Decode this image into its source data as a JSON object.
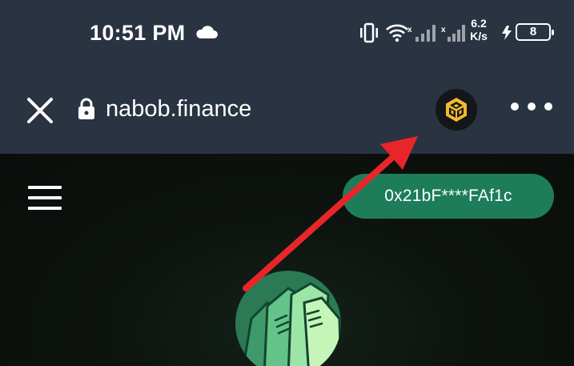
{
  "status_bar": {
    "time": "10:51 PM",
    "net_speed_value": "6.2",
    "net_speed_unit": "K/s",
    "battery_level": "8",
    "icons": [
      "cloud-icon",
      "vibrate-icon",
      "wifi-icon",
      "signal-icon",
      "signal-icon",
      "charging-icon",
      "battery-icon"
    ]
  },
  "browser": {
    "url": "nabob.finance",
    "icons": [
      "close-icon",
      "lock-icon",
      "bnb-icon",
      "more-icon"
    ],
    "bnb_color": "#f3ba2f"
  },
  "page": {
    "wallet_address": "0x21bF****FAf1c",
    "accent_color": "#1d7d5a",
    "icons": [
      "hamburger-icon",
      "nabob-logo"
    ]
  },
  "annotation": {
    "type": "red-arrow",
    "color": "#e8262a",
    "points_to": "bnb-icon"
  }
}
